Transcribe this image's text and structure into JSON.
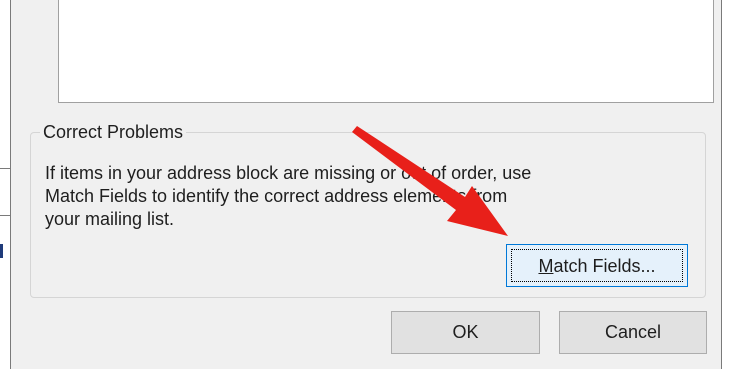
{
  "group": {
    "title": "Correct Problems",
    "lines": [
      "If items in your address block are missing or out of order, use",
      "Match Fields to identify the correct address elements from",
      "your mailing list."
    ]
  },
  "buttons": {
    "match_fields": {
      "accel": "M",
      "rest": "atch Fields..."
    },
    "ok": "OK",
    "cancel": "Cancel"
  },
  "annotation": {
    "color": "#e8201a"
  }
}
